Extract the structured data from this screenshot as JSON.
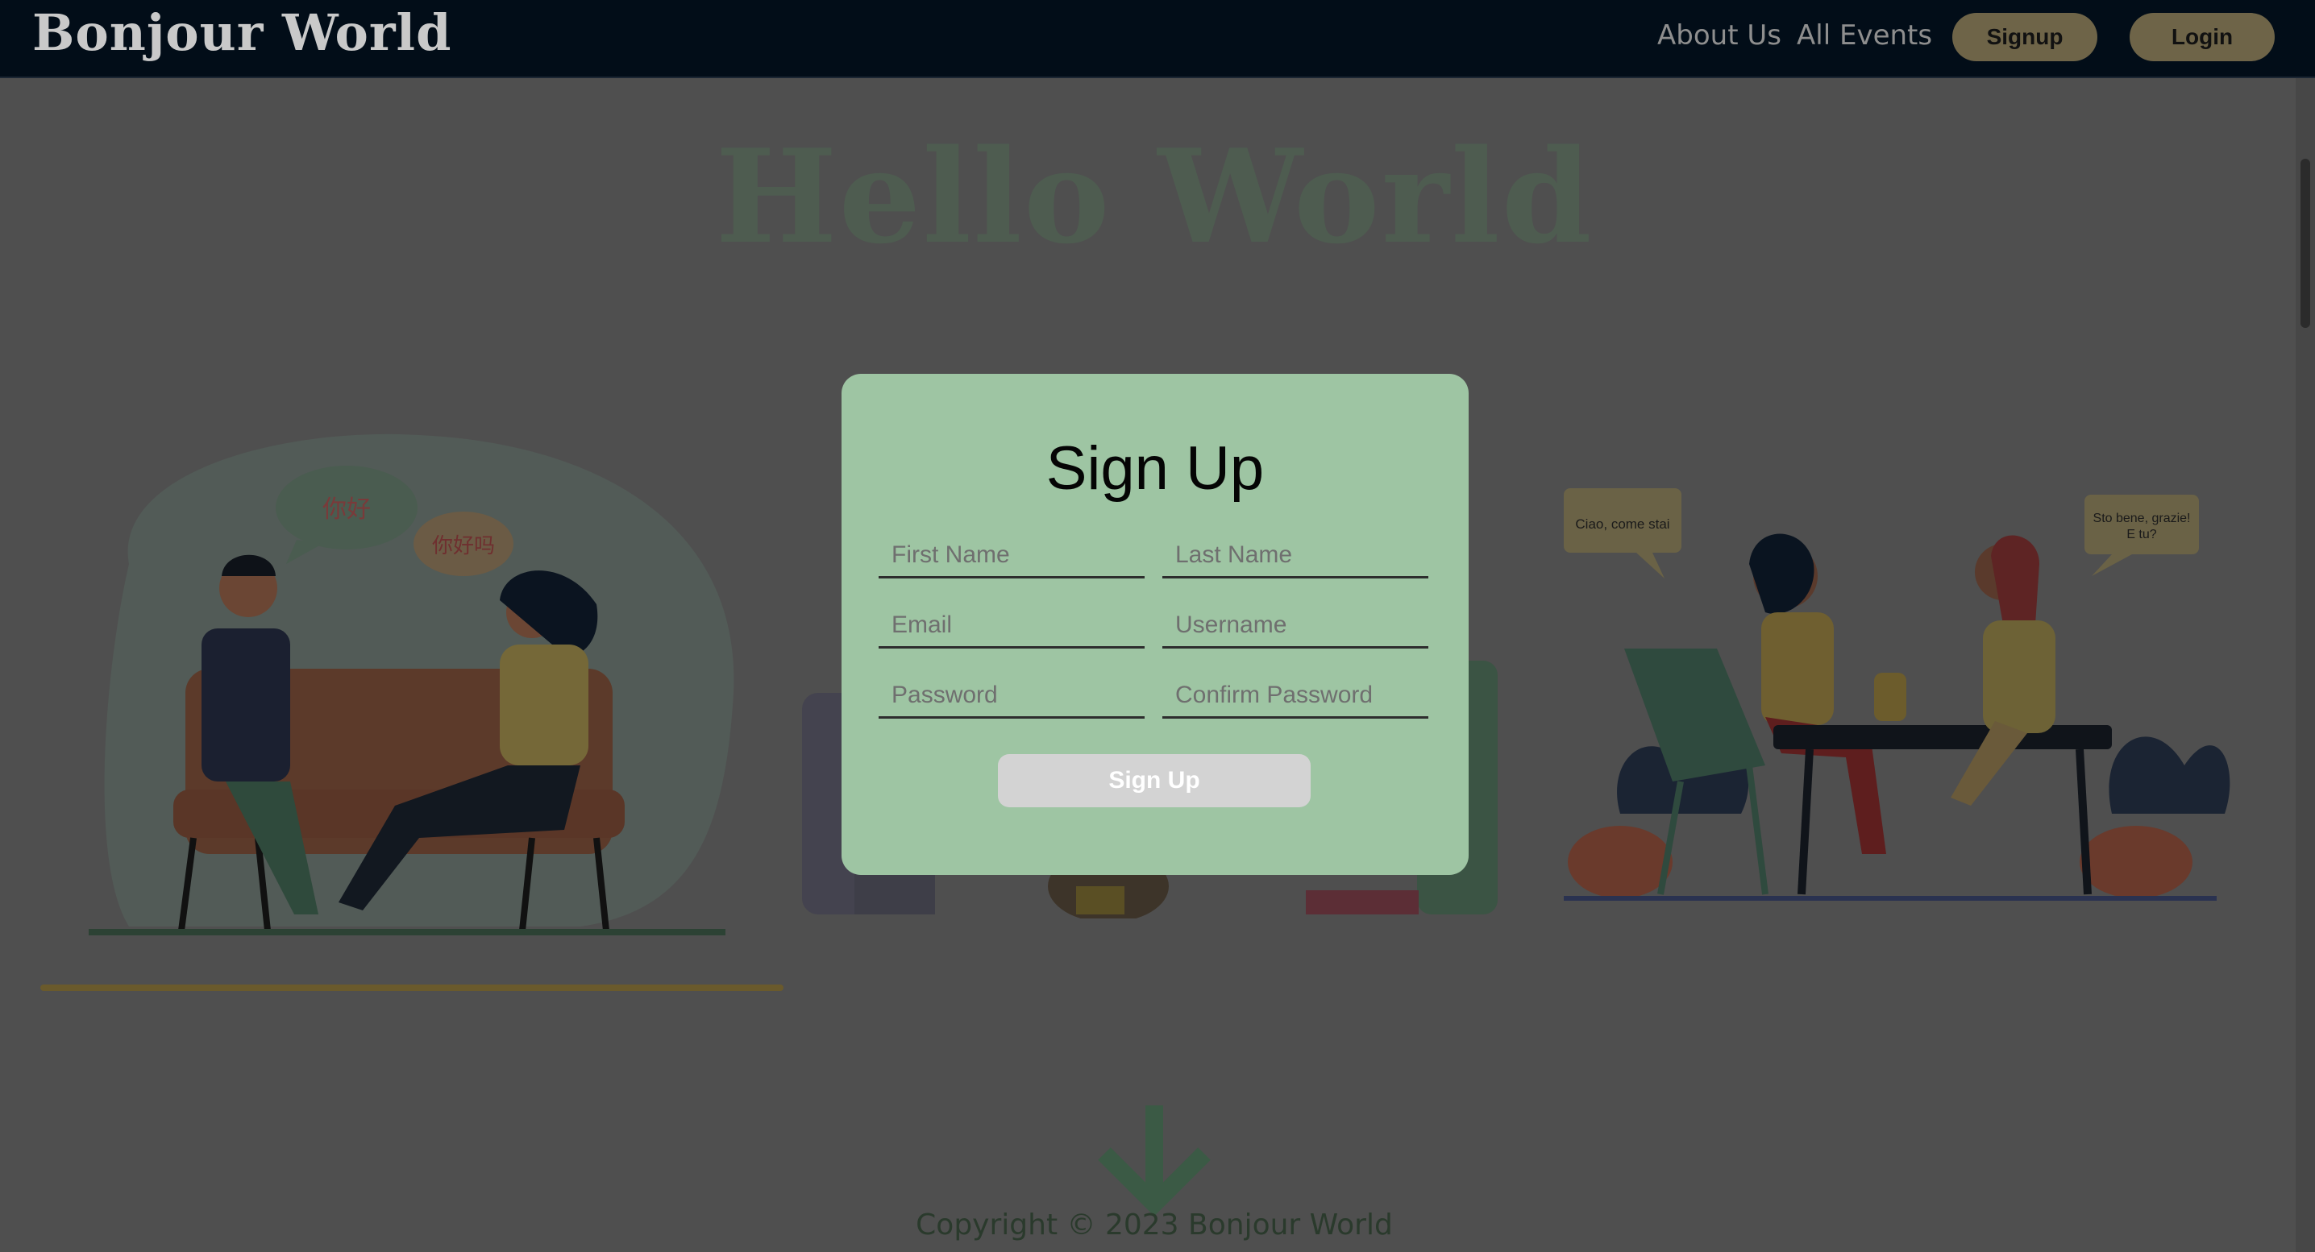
{
  "navbar": {
    "brand": "Bonjour World",
    "links": [
      "About Us",
      "All Events"
    ],
    "signup_label": "Signup",
    "login_label": "Login"
  },
  "hero": {
    "title": "Hello World",
    "left_bubbles": [
      "你好",
      "你好吗"
    ],
    "right_bubbles": [
      "Ciao, come stai",
      "Sto bene, grazie! E tu?"
    ]
  },
  "modal": {
    "title": "Sign Up",
    "fields": {
      "first_name": "First Name",
      "last_name": "Last Name",
      "email": "Email",
      "username": "Username",
      "password": "Password",
      "confirm_password": "Confirm Password"
    },
    "submit_label": "Sign Up"
  },
  "footer": {
    "copyright": "Copyright © 2023 Bonjour World"
  },
  "colors": {
    "navbar_bg": "#020d18",
    "modal_bg": "#9ec5a3",
    "overlay": "#4f4f4f",
    "button_bg": "#6e6448"
  }
}
